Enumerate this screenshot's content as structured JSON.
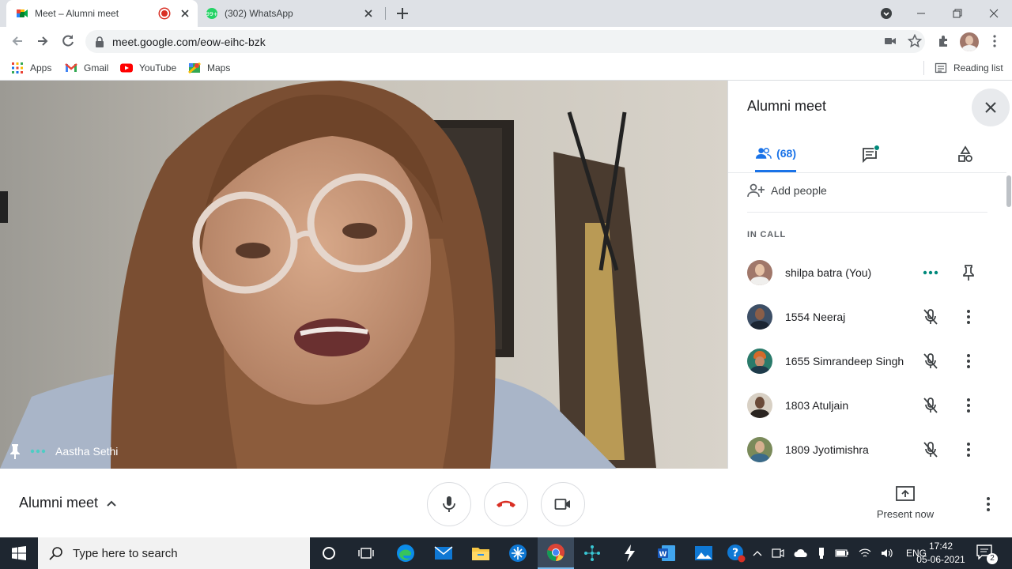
{
  "browser": {
    "tabs": [
      {
        "title": "Meet – Alumni meet",
        "active": true,
        "recording": true
      },
      {
        "title": "(302) WhatsApp",
        "active": false
      }
    ],
    "url": "meet.google.com/eow-eihc-bzk",
    "bookmarks": [
      "Apps",
      "Gmail",
      "YouTube",
      "Maps"
    ],
    "reading_list": "Reading list"
  },
  "video": {
    "speaker_name": "Aastha Sethi"
  },
  "panel": {
    "title": "Alumni meet",
    "people_count": "(68)",
    "add_people": "Add people",
    "section_label": "IN CALL",
    "participants": [
      {
        "name": "shilpa batra (You)",
        "avatar_color": "#a0776a"
      },
      {
        "name": "1554 Neeraj",
        "avatar_color": "#3d4f66"
      },
      {
        "name": "1655 Simrandeep Singh",
        "avatar_color": "#c47a3a"
      },
      {
        "name": "1803 Atuljain",
        "avatar_color": "#4a3a30"
      },
      {
        "name": "1809 Jyotimishra",
        "avatar_color": "#7a8a5a"
      }
    ]
  },
  "controls": {
    "meeting_name": "Alumni meet",
    "present_now": "Present now"
  },
  "taskbar": {
    "search_placeholder": "Type here to search",
    "language": "ENG",
    "time": "17:42",
    "date": "05-06-2021",
    "notification_count": "2"
  },
  "colors": {
    "accent": "#1a73e8",
    "end_call": "#d93025",
    "meet_green": "#00897b"
  }
}
